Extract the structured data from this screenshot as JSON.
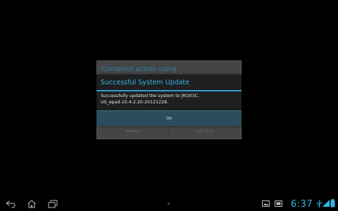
{
  "chooser": {
    "title": "Complete action using",
    "buttons": [
      "Always",
      "Just once"
    ]
  },
  "update_dialog": {
    "title": "Successful System Update",
    "message_line1": "Successfully updated the system to JRO03C.",
    "message_line2": "US_epad-10.4.2.20-20121228.",
    "ok_label": "OK"
  },
  "status_bar": {
    "time": "6:37",
    "icons": [
      "back-icon",
      "home-icon",
      "recent-apps-icon",
      "gallery-icon",
      "screenshot-icon",
      "wifi-icon",
      "usb-icon",
      "battery-icon"
    ]
  },
  "colors": {
    "accent": "#34b5e5",
    "dialog_bg": "#1e1f20",
    "chooser_bg": "#444546",
    "ok_bg": "#2c4d5d"
  }
}
